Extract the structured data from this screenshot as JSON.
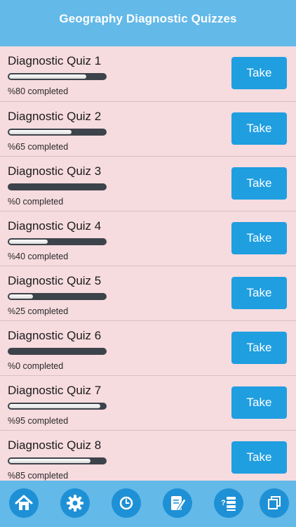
{
  "header": {
    "title": "Geography Diagnostic Quizzes"
  },
  "quizzes": [
    {
      "name": "Diagnostic Quiz 1",
      "progress": 0.8,
      "status": "%80 completed",
      "button": "Take"
    },
    {
      "name": "Diagnostic Quiz 2",
      "progress": 0.65,
      "status": "%65 completed",
      "button": "Take"
    },
    {
      "name": "Diagnostic Quiz 3",
      "progress": 0.0,
      "status": "%0 completed",
      "button": "Take"
    },
    {
      "name": "Diagnostic Quiz 4",
      "progress": 0.4,
      "status": "%40 completed",
      "button": "Take"
    },
    {
      "name": "Diagnostic Quiz 5",
      "progress": 0.25,
      "status": "%25 completed",
      "button": "Take"
    },
    {
      "name": "Diagnostic Quiz 6",
      "progress": 0.0,
      "status": "%0 completed",
      "button": "Take"
    },
    {
      "name": "Diagnostic Quiz 7",
      "progress": 0.95,
      "status": "%95 completed",
      "button": "Take"
    },
    {
      "name": "Diagnostic Quiz 8",
      "progress": 0.85,
      "status": "%85 completed",
      "button": "Take"
    }
  ],
  "tabbar": {
    "items": [
      {
        "icon": "home-icon"
      },
      {
        "icon": "gear-icon"
      },
      {
        "icon": "clock-icon"
      },
      {
        "icon": "edit-note-icon"
      },
      {
        "icon": "quiz-list-icon"
      },
      {
        "icon": "copy-icon"
      }
    ]
  },
  "colors": {
    "header": "#63b9e8",
    "background": "#f6dbdf",
    "button": "#1f9ee0",
    "bar_track": "#3d434a",
    "tab_circle": "#1e90d6"
  }
}
